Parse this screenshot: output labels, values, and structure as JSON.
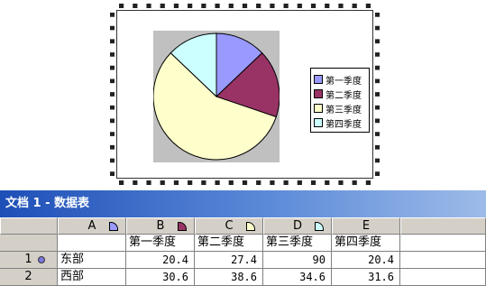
{
  "chart": {
    "legend": [
      "第一季度",
      "第二季度",
      "第三季度",
      "第四季度"
    ],
    "colors": [
      "#9999ff",
      "#993366",
      "#ffffcc",
      "#ccffff"
    ]
  },
  "chart_data": {
    "type": "pie",
    "categories": [
      "第一季度",
      "第二季度",
      "第三季度",
      "第四季度"
    ],
    "values": [
      20.4,
      27.4,
      90,
      20.4
    ],
    "legend_position": "right"
  },
  "datasheet": {
    "title": "文档 1 - 数据表",
    "columns": [
      {
        "letter": "A",
        "icon_color": "#9999ff"
      },
      {
        "letter": "B",
        "icon_color": "#993366"
      },
      {
        "letter": "C",
        "icon_color": "#ffffcc"
      },
      {
        "letter": "D",
        "icon_color": "#ccffff"
      },
      {
        "letter": "E",
        "icon_color": ""
      }
    ],
    "header_row": [
      "第一季度",
      "第二季度",
      "第三季度",
      "第四季度"
    ],
    "rows": [
      {
        "num": "1",
        "label": "东部",
        "values": [
          "20.4",
          "27.4",
          "90",
          "20.4"
        ]
      },
      {
        "num": "2",
        "label": "西部",
        "values": [
          "30.6",
          "38.6",
          "34.6",
          "31.6"
        ]
      }
    ]
  }
}
